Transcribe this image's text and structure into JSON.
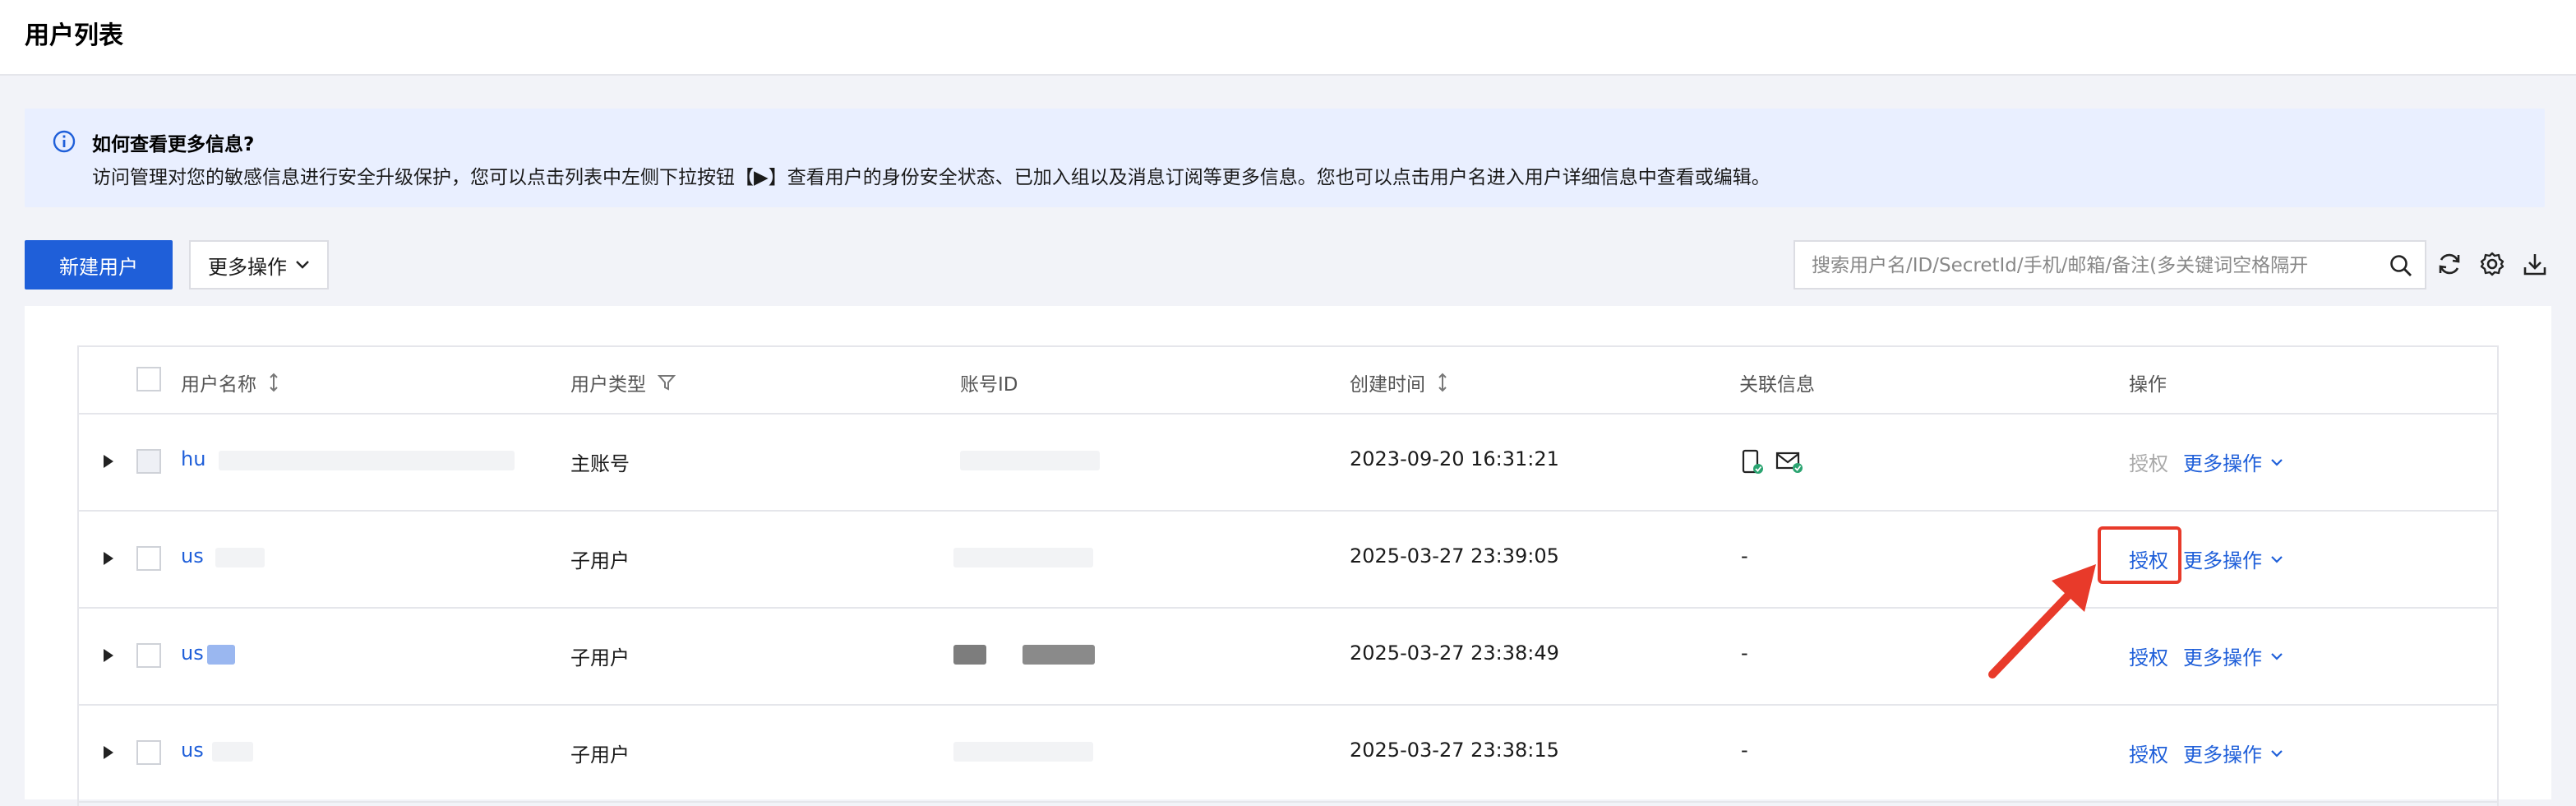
{
  "page": {
    "title": "用户列表"
  },
  "info": {
    "title": "如何查看更多信息?",
    "description": "访问管理对您的敏感信息进行安全升级保护，您可以点击列表中左侧下拉按钮【▶】查看用户的身份安全状态、已加入组以及消息订阅等更多信息。您也可以点击用户名进入用户详细信息中查看或编辑。"
  },
  "toolbar": {
    "new_user_label": "新建用户",
    "more_ops_label": "更多操作",
    "search_placeholder": "搜索用户名/ID/SecretId/手机/邮箱/备注(多关键词空格隔开"
  },
  "table": {
    "headers": {
      "name": "用户名称",
      "type": "用户类型",
      "account_id": "账号ID",
      "created": "创建时间",
      "linked": "关联信息",
      "actions": "操作"
    },
    "rows": [
      {
        "name": "hu",
        "type": "主账号",
        "created": "2023-09-20 16:31:21",
        "linked": "",
        "authorize": "授权",
        "more": "更多操作"
      },
      {
        "name": "us",
        "type": "子用户",
        "created": "2025-03-27 23:39:05",
        "linked": "-",
        "authorize": "授权",
        "more": "更多操作"
      },
      {
        "name": "us",
        "type": "子用户",
        "created": "2025-03-27 23:38:49",
        "linked": "-",
        "authorize": "授权",
        "more": "更多操作"
      },
      {
        "name": "us",
        "type": "子用户",
        "created": "2025-03-27 23:38:15",
        "linked": "-",
        "authorize": "授权",
        "more": "更多操作"
      }
    ]
  },
  "colors": {
    "primary": "#1f5fd9",
    "annotation": "#e83a2a",
    "info_bg": "#e9efff"
  },
  "icons": [
    "info-icon",
    "search-icon",
    "refresh-icon",
    "gear-icon",
    "download-icon",
    "phone-verified-icon",
    "mail-verified-icon",
    "sort-icon",
    "filter-icon",
    "chevron-down-icon",
    "expand-arrow-icon"
  ]
}
